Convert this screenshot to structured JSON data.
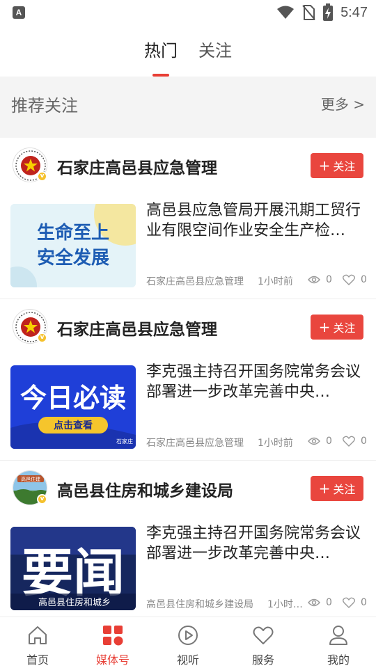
{
  "status_bar": {
    "left_icon_letter": "A",
    "time": "5:47",
    "icons": [
      "wifi-icon",
      "no-sim-icon",
      "battery-charging-icon"
    ]
  },
  "top_tabs": [
    {
      "label": "热门",
      "active": true
    },
    {
      "label": "关注",
      "active": false
    }
  ],
  "recommend": {
    "title": "推荐关注",
    "more_label": "更多 >"
  },
  "cards": [
    {
      "org_name": "石家庄高邑县应急管理",
      "follow_label": "关注",
      "avatar": "emblem",
      "article_title": "高邑县应急管局开展汛期工贸行业有限空间作业安全生产检…",
      "thumb": {
        "line1": "生命至上",
        "line2": "安全发展"
      },
      "source": "石家庄高邑县应急管理",
      "time": "1小时前",
      "views": "0",
      "likes": "0"
    },
    {
      "org_name": "石家庄高邑县应急管理",
      "follow_label": "关注",
      "avatar": "emblem",
      "article_title": "李克强主持召开国务院常务会议 部署进一步改革完善中央…",
      "thumb": {
        "line1": "今日必读",
        "button": "点击查看",
        "watermark": "石家庄"
      },
      "source": "石家庄高邑县应急管理",
      "time": "1小时前",
      "views": "0",
      "likes": "0"
    },
    {
      "org_name": "高邑县住房和城乡建设局",
      "follow_label": "关注",
      "avatar": "landscape",
      "avatar_text": "高邑住建",
      "article_title": "李克强主持召开国务院常务会议 部署进一步改革完善中央…",
      "thumb": {
        "big": "要闻",
        "caption": "高邑县住房和城乡"
      },
      "source": "高邑县住房和城乡建设局",
      "time": "1小时…",
      "views": "0",
      "likes": "0"
    }
  ],
  "bottom_nav": [
    {
      "label": "首页",
      "icon": "home-icon",
      "active": false
    },
    {
      "label": "媒体号",
      "icon": "media-grid-icon",
      "active": true
    },
    {
      "label": "视听",
      "icon": "play-circle-icon",
      "active": false
    },
    {
      "label": "服务",
      "icon": "heart-icon",
      "active": false
    },
    {
      "label": "我的",
      "icon": "profile-icon",
      "active": false
    }
  ],
  "colors": {
    "accent": "#e83e35",
    "follow_button": "#e9463e",
    "verified_badge": "#f5c12c"
  }
}
